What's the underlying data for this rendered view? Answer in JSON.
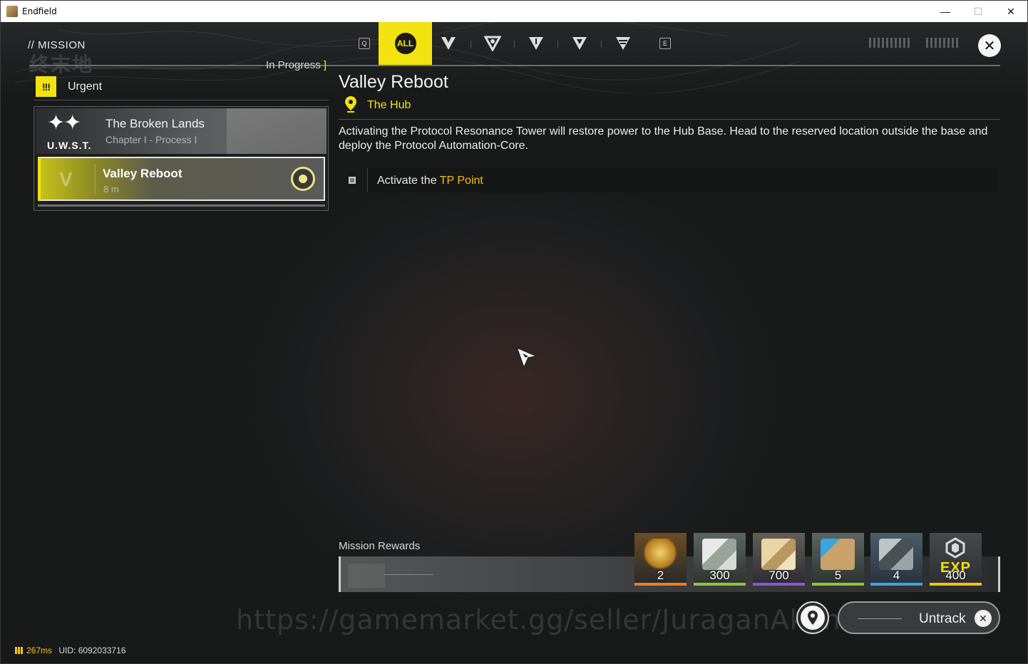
{
  "window": {
    "title": "Endfield",
    "min_icon": "minimize-icon",
    "max_icon": "maximize-icon",
    "close_icon": "close-icon"
  },
  "header": {
    "section": "// MISSION",
    "tabs": [
      {
        "id": "all",
        "label": "ALL",
        "selected": true
      },
      {
        "id": "cat1",
        "icon": "mission-type-1-icon"
      },
      {
        "id": "cat2",
        "icon": "mission-type-2-icon"
      },
      {
        "id": "cat3",
        "icon": "mission-type-3-icon"
      },
      {
        "id": "cat4",
        "icon": "mission-type-4-icon"
      },
      {
        "id": "cat5",
        "icon": "mission-type-5-icon"
      }
    ],
    "left_key": "Q",
    "right_key": "E",
    "accent": "#f2e210"
  },
  "sidebar": {
    "filter_label": "In Progress",
    "group": {
      "badge": "!!!",
      "label": "Urgent"
    },
    "chapter": {
      "logo_text": "U.W.S.T.",
      "title": "The Broken Lands",
      "subtitle": "Chapter I - Process I"
    },
    "missions": [
      {
        "name": "Valley Reboot",
        "distance": "8 m",
        "tracked": true
      }
    ]
  },
  "detail": {
    "title": "Valley Reboot",
    "location": "The Hub",
    "description": "Activating the Protocol Resonance Tower will restore power to the Hub Base. Head to the reserved location outside the base and deploy the Protocol Automation-Core.",
    "objective_prefix": "Activate the ",
    "objective_highlight": "TP Point"
  },
  "rewards": {
    "label": "Mission Rewards",
    "items": [
      {
        "name": "gold-crystal",
        "count": "2",
        "rarity_color": "#ef7b25"
      },
      {
        "name": "ticket",
        "count": "300",
        "rarity_color": "#8ec63f"
      },
      {
        "name": "currency-notes",
        "count": "700",
        "rarity_color": "#8a56d8"
      },
      {
        "name": "exp-book",
        "count": "5",
        "rarity_color": "#8ec63f"
      },
      {
        "name": "device-kit",
        "count": "4",
        "rarity_color": "#3aa6de"
      },
      {
        "name": "exp",
        "label": "EXP",
        "count": "400",
        "rarity_color": "#f2c20f"
      }
    ]
  },
  "actions": {
    "untrack_label": "Untrack"
  },
  "watermark": "https://gamemarket.gg/seller/JuraganAkun",
  "status": {
    "ping": "267ms",
    "uid": "UID: 6092033716"
  }
}
